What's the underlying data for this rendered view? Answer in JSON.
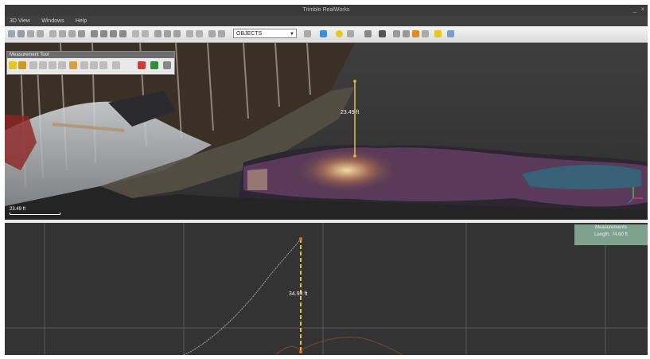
{
  "window": {
    "title": "Trimble RealWorks"
  },
  "menu": [
    {
      "label": "3D View"
    },
    {
      "label": "Windows"
    },
    {
      "label": "Help"
    }
  ],
  "toolbar": {
    "selection_value": "OBJECTS"
  },
  "measurement_panel": {
    "title": "Measurement Tool"
  },
  "viewport": {
    "height_label": "23.49 ft",
    "scale_label": "23.49 ft"
  },
  "profile": {
    "height_label": "34.93 ft",
    "info_title": "Measurements",
    "info_length": "Length: 74.60 ft"
  },
  "colors": {
    "accent_yellow": "#e2c040",
    "info_green": "#7fa28f"
  }
}
